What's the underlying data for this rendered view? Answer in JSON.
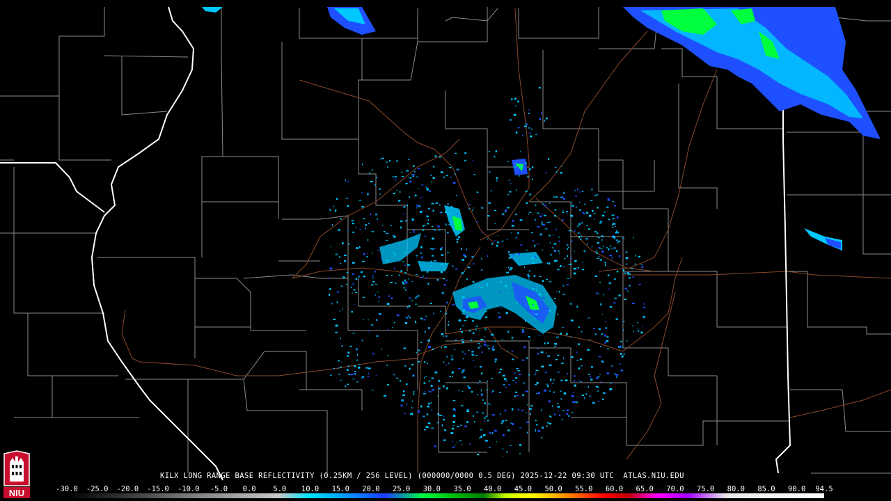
{
  "product": {
    "caption": "KILX LONG RANGE BASE REFLECTIVITY (0.25KM / 256 LEVEL) (000000/0000 0.5 DEG) 2025-12-22 09:30 UTC  ATLAS.NIU.EDU"
  },
  "logo": {
    "text": "NIU",
    "colors": {
      "red": "#c8102e",
      "white": "#ffffff",
      "black": "#000000"
    }
  },
  "scale": {
    "labels": [
      "-30.0",
      "-25.0",
      "-20.0",
      "-15.0",
      "-10.0",
      "-5.0",
      "0.0",
      "5.0",
      "10.0",
      "15.0",
      "20.0",
      "25.0",
      "30.0",
      "35.0",
      "40.0",
      "45.0",
      "50.0",
      "55.0",
      "60.0",
      "65.0",
      "70.0",
      "75.0",
      "80.0",
      "85.0",
      "90.0",
      "94.5"
    ],
    "min": -30,
    "max": 94.5
  },
  "colors": {
    "background": "#000000",
    "state_border": "#ffffff",
    "county_border": "#8c8c8c",
    "highway": "#8a4a2a",
    "echo_light": "#00c8ff",
    "echo_medium": "#1e50ff",
    "echo_heavy": "#00ff3c"
  }
}
